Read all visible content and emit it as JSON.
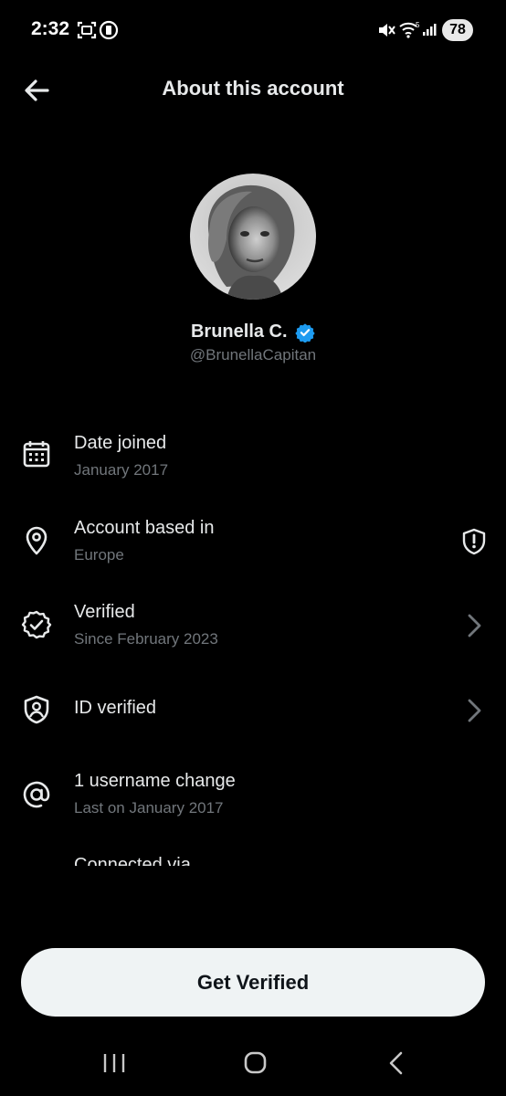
{
  "status_bar": {
    "time": "2:32",
    "battery": "78",
    "icons": [
      "screenshot-icon",
      "dnd-icon",
      "mute-icon",
      "wifi-icon",
      "signal-icon"
    ]
  },
  "header": {
    "title": "About this account",
    "back_icon": "arrow-left-icon"
  },
  "profile": {
    "name": "Brunella C.",
    "handle": "@BrunellaCapitan",
    "verified_badge_color": "#1d9bf0"
  },
  "info_rows": [
    {
      "label": "Date joined",
      "sub": "January 2017",
      "icon": "calendar-icon",
      "trailing": null
    },
    {
      "label": "Account based in",
      "sub": "Europe",
      "icon": "location-pin-icon",
      "trailing": "shield-alert-icon"
    },
    {
      "label": "Verified",
      "sub": "Since February 2023",
      "icon": "verified-badge-icon",
      "trailing": "chevron-right-icon"
    },
    {
      "label": "ID verified",
      "sub": "",
      "icon": "id-shield-icon",
      "trailing": "chevron-right-icon"
    },
    {
      "label": "1 username change",
      "sub": "Last on January 2017",
      "icon": "at-sign-icon",
      "trailing": null
    },
    {
      "label": "Connected via",
      "sub": "",
      "icon": "globe-icon",
      "trailing": null
    }
  ],
  "cta": {
    "label": "Get Verified"
  },
  "colors": {
    "background": "#000000",
    "primary_text": "#e7e9ea",
    "secondary_text": "#71767b",
    "accent_blue": "#1d9bf0",
    "button_bg": "#eff3f4"
  }
}
